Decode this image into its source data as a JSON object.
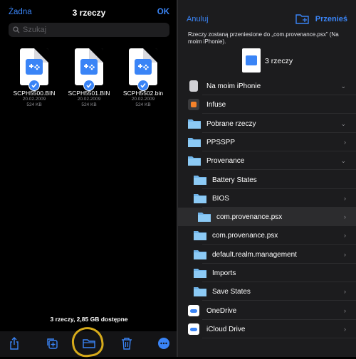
{
  "left": {
    "cancel": "Żadna",
    "title": "3 rzeczy",
    "done": "OK",
    "search_placeholder": "Szukaj",
    "files": [
      {
        "name": "SCPH5500.BIN",
        "date": "20.02.2009",
        "size": "524 KB"
      },
      {
        "name": "SCPH5501.BIN",
        "date": "20.02.2009",
        "size": "524 KB"
      },
      {
        "name": "SCPH5502.bin",
        "date": "20.02.2009",
        "size": "524 KB"
      }
    ],
    "status": "3 rzeczy, 2,85 GB dostępne"
  },
  "right": {
    "cancel": "Anuluj",
    "move": "Przenieś",
    "message": "Rzeczy zostaną przeniesione do „com.provenance.psx” (Na moim iPhonie).",
    "preview_count": "3 rzeczy",
    "rows": [
      {
        "label": "Na moim iPhonie",
        "kind": "phone",
        "chev": "down"
      },
      {
        "label": "Infuse",
        "kind": "app",
        "chev": ""
      },
      {
        "label": "Pobrane rzeczy",
        "kind": "downloads",
        "chev": "down"
      },
      {
        "label": "PPSSPP",
        "kind": "folder-app",
        "chev": "right"
      },
      {
        "label": "Provenance",
        "kind": "folder-app",
        "chev": "down"
      },
      {
        "label": "Battery States",
        "kind": "folder",
        "chev": ""
      },
      {
        "label": "BIOS",
        "kind": "folder",
        "chev": "right"
      },
      {
        "label": "com.provenance.psx",
        "kind": "folder",
        "chev": "right",
        "selected": true
      },
      {
        "label": "com.provenance.psx",
        "kind": "folder",
        "chev": "right"
      },
      {
        "label": "default.realm.management",
        "kind": "folder",
        "chev": "right"
      },
      {
        "label": "Imports",
        "kind": "folder",
        "chev": ""
      },
      {
        "label": "Save States",
        "kind": "folder",
        "chev": "right"
      },
      {
        "label": "OneDrive",
        "kind": "cloud",
        "chev": "right"
      },
      {
        "label": "iCloud Drive",
        "kind": "cloud",
        "chev": "right"
      }
    ]
  },
  "colors": {
    "accent": "#3a84f6",
    "highlight": "#e8b91c"
  }
}
